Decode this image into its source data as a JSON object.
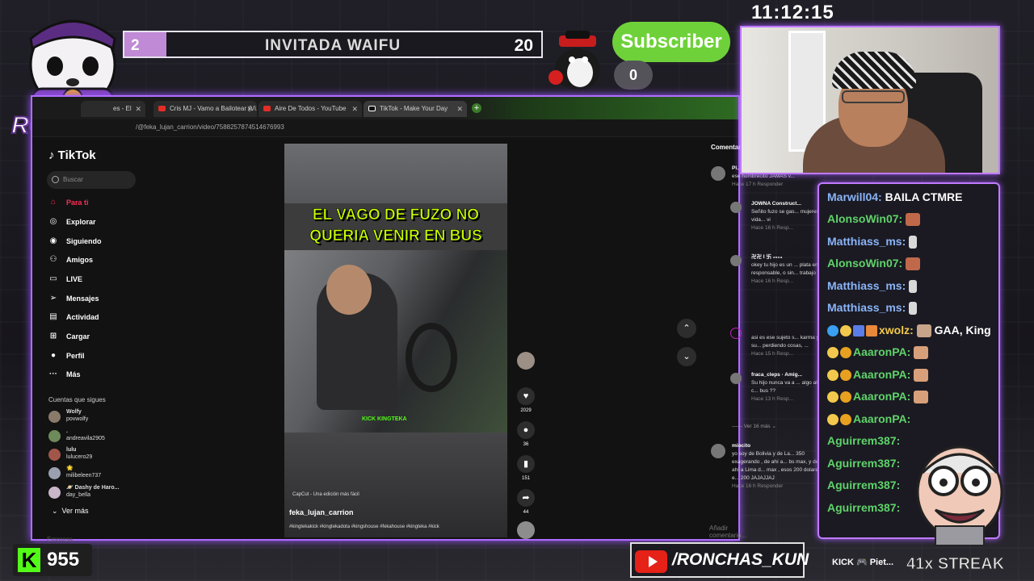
{
  "clock": "11:12:15",
  "goal": {
    "current": "2",
    "title": "INVITADA WAIFU",
    "target": "20",
    "progress": 0.1
  },
  "subscriber": {
    "label": "Subscriber",
    "count": "0"
  },
  "logo_text": "RONCHAS",
  "browser": {
    "tabs": [
      {
        "label": "Cris MJ - Vamo a Bailotear (Vi..."
      },
      {
        "label": "Aire De Todos - YouTube"
      },
      {
        "label": "TikTok - Make Your Day"
      }
    ],
    "partial_tab": "es - El",
    "url": "/@feka_lujan_carrion/video/7588257874514676993"
  },
  "tiktok": {
    "brand": "TikTok",
    "search_placeholder": "Buscar",
    "nav": [
      "Para ti",
      "Explorar",
      "Siguiendo",
      "Amigos",
      "LIVE",
      "Mensajes",
      "Actividad",
      "Cargar",
      "Perfil",
      "Más"
    ],
    "following_header": "Cuentas que sigues",
    "following": [
      {
        "name": "Wolfy",
        "handle": "povwolfy"
      },
      {
        "name": ".",
        "handle": "andreavila2905"
      },
      {
        "name": "lulu",
        "handle": "lulucero29"
      },
      {
        "name": "🌟",
        "handle": "milibeleen737"
      },
      {
        "name": "🪐 Dashy de Haro...",
        "handle": "day_bella"
      }
    ],
    "see_more": "Ver más",
    "footer": "Empresa"
  },
  "video": {
    "caption": "EL VAGO DE FUZO NO QUERIA VENIR EN BUS",
    "watermark": "KICK KINGTEKA",
    "capcut": "CapCut - Una edición más fácil",
    "username": "feka_lujan_carrion",
    "hashtags": "#kingtekakick #kingtekadota #kingshouse #fekahouse #kingteka #kick",
    "likes": "2029",
    "comments": "36",
    "saves": "151",
    "shares": "44"
  },
  "comments": {
    "header": "Comentarios",
    "items": [
      {
        "user": "Pl...",
        "text": "ese hombrecito JAMAS v...",
        "meta": "Hace 17 h   Responder"
      },
      {
        "user": "JOWNA Construct...",
        "text": "Señito fuzo se gas... mujeres de la vida... vi",
        "meta": "Hace 16 h   Resp..."
      },
      {
        "user": "卍卍 I 卐 ₂₅₀₃",
        "text": "okey tu hijo es un ... plata en La'ikas... q responsable, o sin... trabajo y listo",
        "meta": "Hace 16 h   Resp..."
      },
      {
        "user": "",
        "text": "asi es ese sujeto s... karma ya perdió su... perdiendo cosas, ...",
        "meta": "Hace 15 h   Resp..."
      },
      {
        "user": "fraca_cleps · Amig...",
        "text": "Su hijo nunca va a ... algo ahorrado ?? c... bus ??",
        "meta": "Hace 13 h   Resp..."
      },
      {
        "user": "",
        "text": "—— Ver 16 más ⌄",
        "meta": ""
      },
      {
        "user": "miocito",
        "text": "yo soy de Bolivia y de La... 350 exagerando , de ahí a... bs max, y de ahí a Lima d... max , esos 200 dolares e... 200 JAJAJJAJ",
        "meta": "Hace 16 h   Responder"
      }
    ],
    "add_placeholder": "Añadir comentario..."
  },
  "chat": [
    {
      "user": "Marwill04:",
      "text": "BAILA CTMRE",
      "color": "#8ab4f8"
    },
    {
      "user": "AlonsoWin07:",
      "text": "",
      "color": "#5fd36a"
    },
    {
      "user": "Matthiass_ms:",
      "text": "",
      "color": "#8ab4f8"
    },
    {
      "user": "AlonsoWin07:",
      "text": "",
      "color": "#5fd36a"
    },
    {
      "user": "Matthiass_ms:",
      "text": "",
      "color": "#8ab4f8"
    },
    {
      "user": "Matthiass_ms:",
      "text": "",
      "color": "#8ab4f8"
    },
    {
      "user": "xwolz:",
      "text": "GAA, King",
      "color": "#f2c94c"
    },
    {
      "user": "AaaronPA:",
      "text": "",
      "color": "#5fd36a"
    },
    {
      "user": "AaaronPA:",
      "text": "",
      "color": "#5fd36a"
    },
    {
      "user": "AaaronPA:",
      "text": "",
      "color": "#5fd36a"
    },
    {
      "user": "AaaronPA:",
      "text": "",
      "color": "#5fd36a"
    },
    {
      "user": "Aguirrem387:",
      "text": "",
      "color": "#5fd36a"
    },
    {
      "user": "Aguirrem387:",
      "text": "",
      "color": "#5fd36a"
    },
    {
      "user": "Aguirrem387:",
      "text": "",
      "color": "#5fd36a"
    },
    {
      "user": "Aguirrem387:",
      "text": "",
      "color": "#5fd36a"
    }
  ],
  "kick_followers": "955",
  "youtube_handle": "/RONCHAS_KUN",
  "social_row": "KICK 🎮 Piet...",
  "streak": "41x STREAK",
  "colors": {
    "accent": "#b06dff",
    "kick_green": "#53fc18",
    "tiktok_red": "#fe2c55"
  }
}
